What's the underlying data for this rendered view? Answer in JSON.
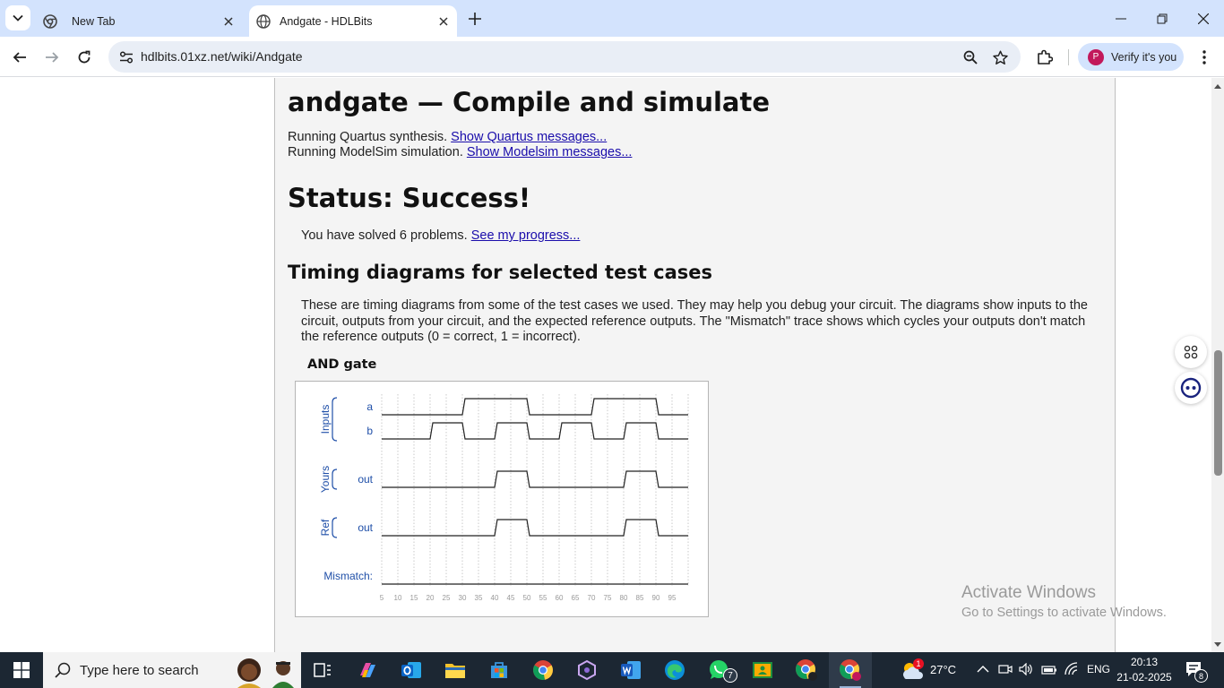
{
  "browser": {
    "tabs": [
      {
        "label": "New Tab",
        "active": false
      },
      {
        "label": "Andgate - HDLBits",
        "active": true
      }
    ],
    "url": "hdlbits.01xz.net/wiki/Andgate",
    "profile_initial": "P",
    "verify_label": "Verify it's you"
  },
  "page": {
    "title": "andgate — Compile and simulate",
    "synth_text": "Running Quartus synthesis. ",
    "synth_link": "Show Quartus messages...",
    "sim_text": "Running ModelSim simulation. ",
    "sim_link": "Show Modelsim messages...",
    "status": "Status: Success!",
    "solved_text": "You have solved 6 problems. ",
    "progress_link": "See my progress...",
    "timing_heading": "Timing diagrams for selected test cases",
    "timing_desc": "These are timing diagrams from some of the test cases we used. They may help you debug your circuit. The diagrams show inputs to the circuit, outputs from your circuit, and the expected reference outputs. The \"Mismatch\" trace shows which cycles your outputs don't match the reference outputs (0 = correct, 1 = incorrect).",
    "testcase_title": "AND gate"
  },
  "waveform": {
    "groups": [
      {
        "label": "Inputs",
        "signals": [
          "a",
          "b"
        ]
      },
      {
        "label": "Yours",
        "signals": [
          "out"
        ]
      },
      {
        "label": "Ref",
        "signals": [
          "out"
        ]
      }
    ],
    "mismatch_label": "Mismatch:",
    "time_ticks": [
      5,
      10,
      15,
      20,
      25,
      30,
      35,
      40,
      45,
      50,
      55,
      60,
      65,
      70,
      75,
      80,
      85,
      90,
      95
    ],
    "a": [
      0,
      0,
      0,
      0,
      0,
      1,
      1,
      1,
      1,
      0,
      0,
      0,
      0,
      1,
      1,
      1,
      1,
      0,
      0
    ],
    "b": [
      0,
      0,
      0,
      1,
      1,
      0,
      0,
      1,
      1,
      0,
      0,
      1,
      1,
      0,
      0,
      1,
      1,
      0,
      0
    ],
    "yours_out": [
      0,
      0,
      0,
      0,
      0,
      0,
      0,
      1,
      1,
      0,
      0,
      0,
      0,
      0,
      0,
      1,
      1,
      0,
      0
    ],
    "ref_out": [
      0,
      0,
      0,
      0,
      0,
      0,
      0,
      1,
      1,
      0,
      0,
      0,
      0,
      0,
      0,
      1,
      1,
      0,
      0
    ],
    "mismatch": [
      0,
      0,
      0,
      0,
      0,
      0,
      0,
      0,
      0,
      0,
      0,
      0,
      0,
      0,
      0,
      0,
      0,
      0,
      0
    ]
  },
  "watermark": {
    "line1": "Activate Windows",
    "line2": "Go to Settings to activate Windows."
  },
  "taskbar": {
    "search_placeholder": "Type here to search",
    "whatsapp_badge": "7",
    "weather_badge": "1",
    "temperature": "27°C",
    "language": "ENG",
    "time": "20:13",
    "date": "21-02-2025",
    "notification_count": "8"
  }
}
